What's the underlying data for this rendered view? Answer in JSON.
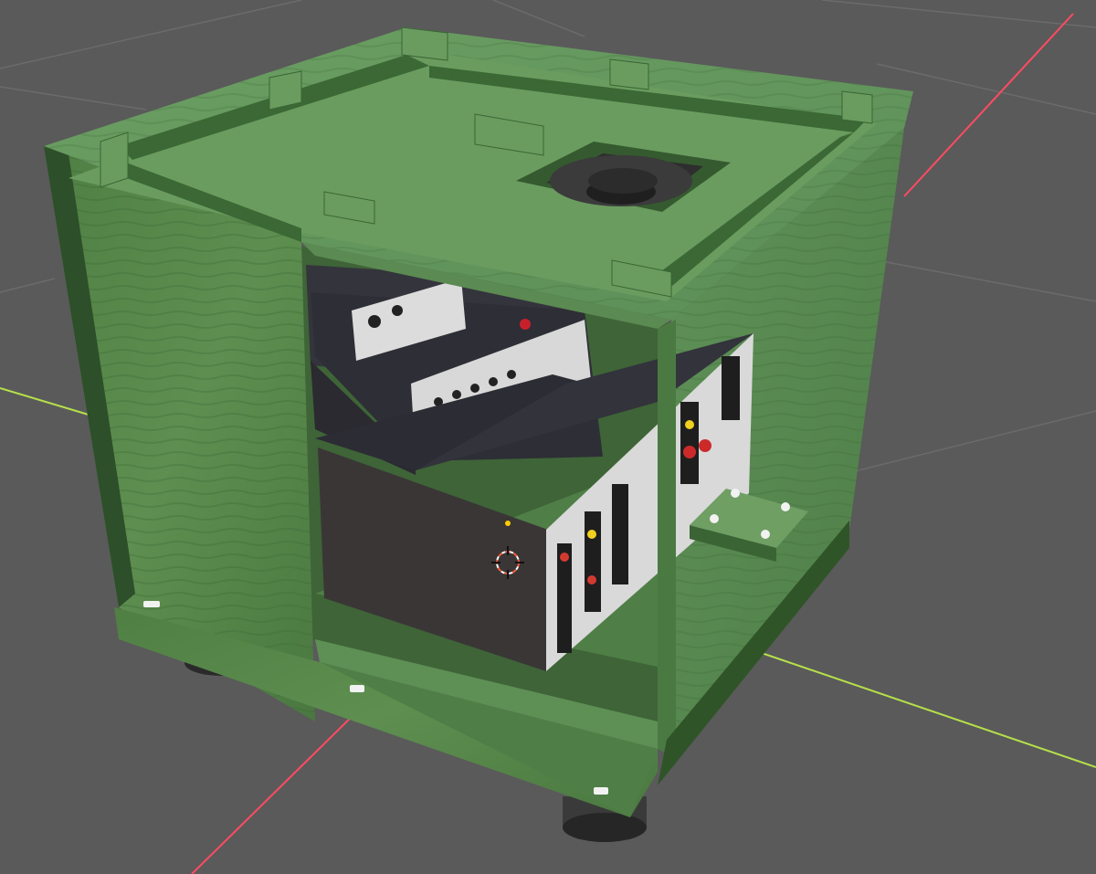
{
  "viewport": {
    "background": "#5a5a5a",
    "grid_color": "#6b6b6b",
    "x_axis_color": "#ff4b62",
    "y_axis_color": "#b6e04a"
  },
  "scene": {
    "wood_light": "#5f8f5a",
    "wood_dark": "#2f4f2a",
    "device_color": "#2b2b33",
    "device_face": "#45454f",
    "cursor_color": "#ff5a3c",
    "origin_dot_color": "#ffcc00",
    "icons": [
      "3d-cursor-icon",
      "origin-dot-icon"
    ]
  }
}
